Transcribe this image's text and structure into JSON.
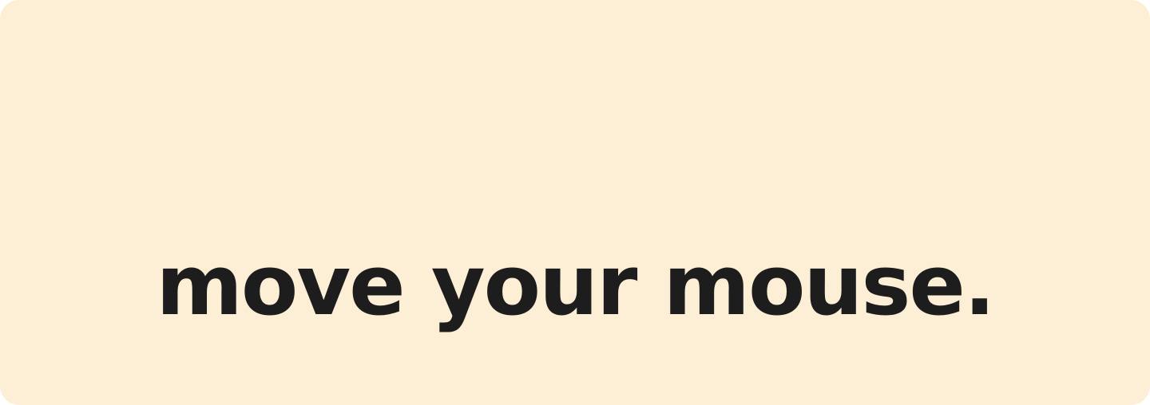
{
  "card": {
    "headline": "move your mouse.",
    "colors": {
      "background": "#fdefd6",
      "text": "#1d1d1d"
    }
  }
}
